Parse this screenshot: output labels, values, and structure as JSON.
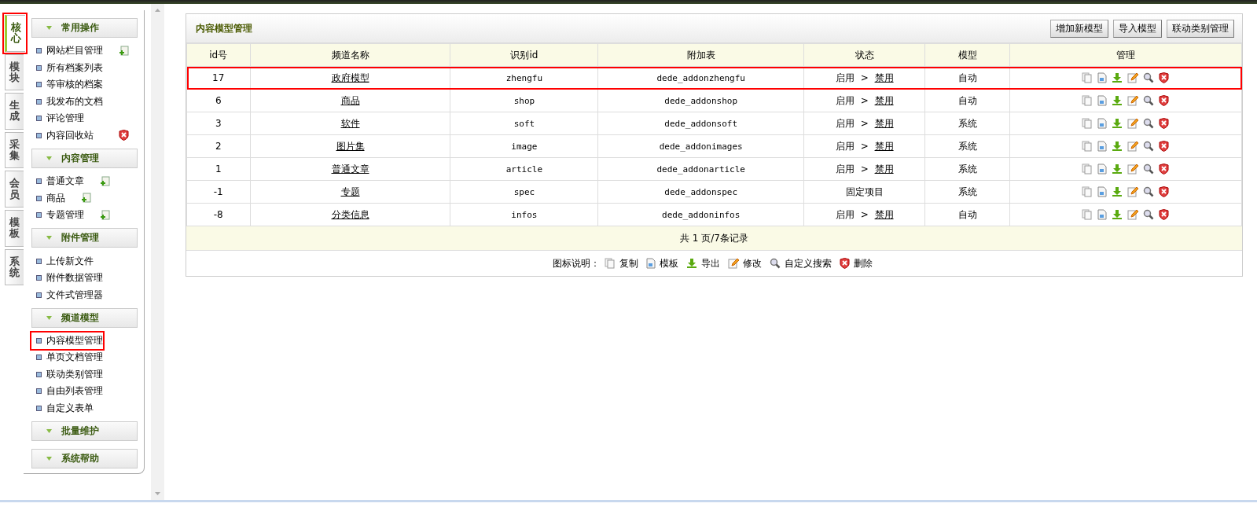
{
  "side_tabs": [
    {
      "label": "核心",
      "selected": true,
      "highlighted": true
    },
    {
      "label": "模块",
      "selected": false,
      "highlighted": false
    },
    {
      "label": "生成",
      "selected": false,
      "highlighted": false
    },
    {
      "label": "采集",
      "selected": false,
      "highlighted": false
    },
    {
      "label": "会员",
      "selected": false,
      "highlighted": false
    },
    {
      "label": "模板",
      "selected": false,
      "highlighted": false
    },
    {
      "label": "系统",
      "selected": false,
      "highlighted": false
    }
  ],
  "sidebar": {
    "groups": [
      {
        "title": "常用操作",
        "items": [
          {
            "label": "网站栏目管理",
            "kind": "add",
            "highlighted": false
          },
          {
            "label": "所有档案列表",
            "highlighted": false
          },
          {
            "label": "等审核的档案",
            "highlighted": false
          },
          {
            "label": "我发布的文档",
            "highlighted": false
          },
          {
            "label": "评论管理",
            "highlighted": false
          },
          {
            "label": "内容回收站",
            "kind": "delete",
            "highlighted": false
          }
        ]
      },
      {
        "title": "内容管理",
        "items": [
          {
            "label": "普通文章",
            "kind": "add",
            "highlighted": false
          },
          {
            "label": "商品",
            "kind": "add",
            "highlighted": false
          },
          {
            "label": "专题管理",
            "kind": "add",
            "highlighted": false
          }
        ]
      },
      {
        "title": "附件管理",
        "items": [
          {
            "label": "上传新文件",
            "highlighted": false
          },
          {
            "label": "附件数据管理",
            "highlighted": false
          },
          {
            "label": "文件式管理器",
            "highlighted": false
          }
        ]
      },
      {
        "title": "频道模型",
        "items": [
          {
            "label": "内容模型管理",
            "highlighted": true
          },
          {
            "label": "单页文档管理",
            "highlighted": false
          },
          {
            "label": "联动类别管理",
            "highlighted": false
          },
          {
            "label": "自由列表管理",
            "highlighted": false
          },
          {
            "label": "自定义表单",
            "highlighted": false
          }
        ]
      },
      {
        "title": "批量维护"
      },
      {
        "title": "系统帮助"
      }
    ]
  },
  "panel": {
    "title": "内容模型管理",
    "buttons": [
      "增加新模型",
      "导入模型",
      "联动类别管理"
    ],
    "table": {
      "columns": [
        "id号",
        "频道名称",
        "识别id",
        "附加表",
        "状态",
        "模型",
        "管理"
      ],
      "rows": [
        {
          "id": "17",
          "name": "政府模型",
          "ident": "zhengfu",
          "table": "dede_addonzhengfu",
          "status": "启用",
          "status_sep": ">",
          "status_link": "禁用",
          "model": "自动",
          "highlighted": true
        },
        {
          "id": "6",
          "name": "商品",
          "ident": "shop",
          "table": "dede_addonshop",
          "status": "启用",
          "status_sep": ">",
          "status_link": "禁用",
          "model": "自动",
          "highlighted": false
        },
        {
          "id": "3",
          "name": "软件",
          "ident": "soft",
          "table": "dede_addonsoft",
          "status": "启用",
          "status_sep": ">",
          "status_link": "禁用",
          "model": "系统",
          "highlighted": false
        },
        {
          "id": "2",
          "name": "图片集",
          "ident": "image",
          "table": "dede_addonimages",
          "status": "启用",
          "status_sep": ">",
          "status_link": "禁用",
          "model": "系统",
          "highlighted": false
        },
        {
          "id": "1",
          "name": "普通文章",
          "ident": "article",
          "table": "dede_addonarticle",
          "status": "启用",
          "status_sep": ">",
          "status_link": "禁用",
          "model": "系统",
          "highlighted": false
        },
        {
          "id": "-1",
          "name": "专题",
          "ident": "spec",
          "table": "dede_addonspec",
          "status": "固定项目",
          "model": "系统",
          "highlighted": false
        },
        {
          "id": "-8",
          "name": "分类信息",
          "ident": "infos",
          "table": "dede_addoninfos",
          "status": "启用",
          "status_sep": ">",
          "status_link": "禁用",
          "model": "自动",
          "highlighted": false
        }
      ]
    },
    "pager": "共 1 页/7条记录",
    "legend": {
      "title": "图标说明：",
      "items": [
        {
          "kind": "copy",
          "label": "复制"
        },
        {
          "kind": "template",
          "label": "模板"
        },
        {
          "kind": "export",
          "label": "导出"
        },
        {
          "kind": "edit",
          "label": "修改"
        },
        {
          "kind": "search",
          "label": "自定义搜索"
        },
        {
          "kind": "delete",
          "label": "删除"
        }
      ]
    }
  }
}
